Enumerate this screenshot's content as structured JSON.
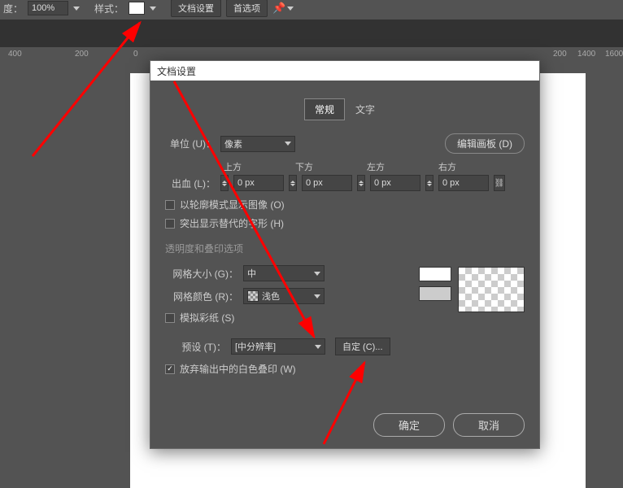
{
  "topbar": {
    "opacity_label": "度：",
    "opacity_value": "100%",
    "style_label": "样式：",
    "doc_setup_btn": "文档设置",
    "prefs_btn": "首选项"
  },
  "ruler": {
    "marks": [
      "400",
      "200",
      "0",
      "200",
      "1400",
      "1600"
    ]
  },
  "dialog": {
    "title": "文档设置",
    "tabs": {
      "general": "常规",
      "text": "文字"
    },
    "unit_label": "单位 (U)：",
    "unit_value": "像素",
    "edit_artboard_btn": "编辑画板 (D)",
    "bleed_label": "出血 (L)：",
    "bleed_cols": {
      "top": "上方",
      "bottom": "下方",
      "left": "左方",
      "right": "右方"
    },
    "bleed_values": {
      "top": "0 px",
      "bottom": "0 px",
      "left": "0 px",
      "right": "0 px"
    },
    "outline_chk": "以轮廓模式显示图像 (O)",
    "alt_glyph_chk": "突出显示替代的字形 (H)",
    "section": "透明度和叠印选项",
    "grid_size_label": "网格大小 (G)：",
    "grid_size_value": "中",
    "grid_color_label": "网格颜色 (R)：",
    "grid_color_value": "浅色",
    "simulate_paper_chk": "模拟彩纸 (S)",
    "preset_label": "预设 (T)：",
    "preset_value": "[中分辨率]",
    "custom_btn": "自定 (C)...",
    "discard_white_chk": "放弃输出中的白色叠印 (W)",
    "ok_btn": "确定",
    "cancel_btn": "取消",
    "colors": {
      "white": "#ffffff",
      "gray": "#cccccc"
    }
  }
}
